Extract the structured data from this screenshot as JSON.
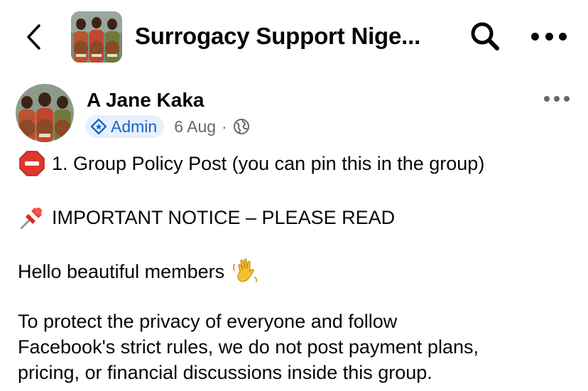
{
  "header": {
    "title": "Surrogacy Support Nige...",
    "back_icon": "chevron-left-icon",
    "search_icon": "search-icon",
    "more_icon": "more-horizontal-icon"
  },
  "post": {
    "author": "A Jane Kaka",
    "role_badge": "Admin",
    "date": "6 Aug",
    "separator": "·",
    "audience_icon": "globe-icon",
    "more_icon": "more-horizontal-icon",
    "paragraphs": [
      {
        "emoji": "stop-sign-emoji",
        "text": "1. Group Policy Post (you can pin this in the group)"
      },
      {
        "emoji": "pushpin-emoji",
        "text": "IMPORTANT NOTICE – PLEASE READ"
      },
      {
        "text": "Hello beautiful members",
        "emoji_after": "waving-hand-emoji"
      },
      {
        "lines": [
          "To protect the privacy of everyone and follow",
          "Facebook's strict rules, we do not post payment plans,",
          "pricing, or financial discussions inside this group."
        ]
      }
    ]
  },
  "colors": {
    "admin_badge_bg": "#e7f0fd",
    "admin_text": "#1565c8",
    "muted": "#65676b",
    "text": "#050505"
  }
}
